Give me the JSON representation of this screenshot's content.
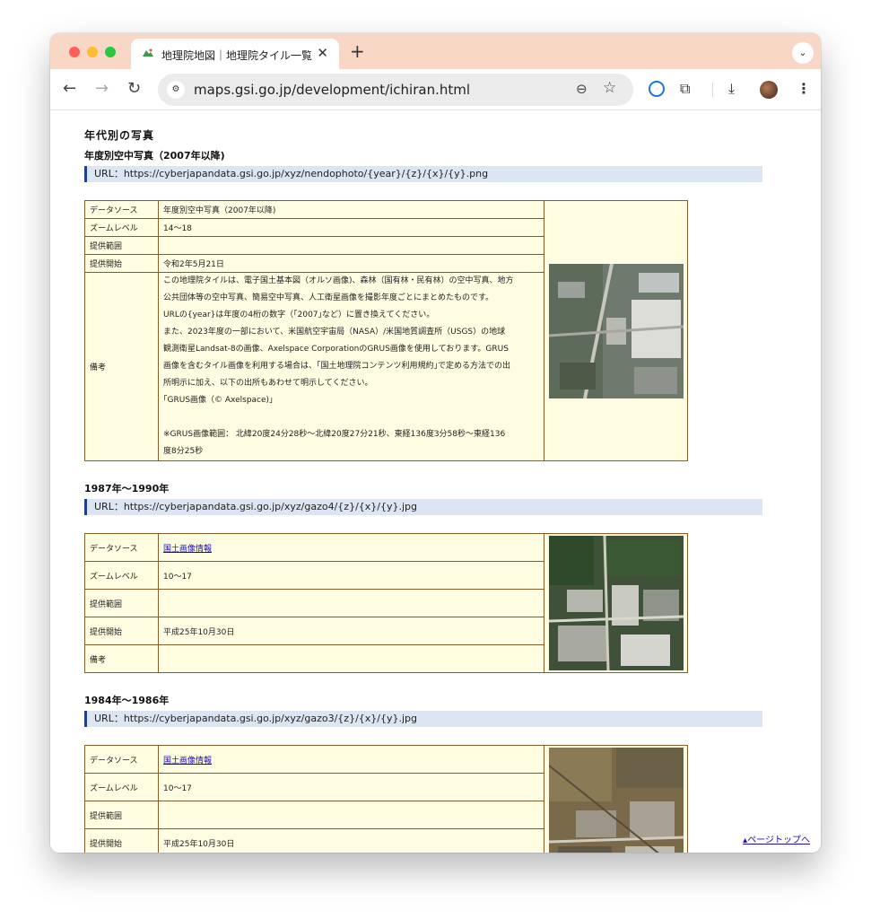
{
  "browser": {
    "tab_title": "地理院地図｜地理院タイル一覧",
    "tab_close": "✕",
    "new_tab": "+",
    "url": "maps.gsi.go.jp/development/ichiran.html"
  },
  "page": {
    "heading": "年代別の写真",
    "sections": [
      {
        "title": "年度別空中写真（2007年以降)",
        "url_line": "URL：https://cyberjapandata.gsi.go.jp/xyz/nendophoto/{year}/{z}/{x}/{y}.png",
        "rows": {
          "source_label": "データソース",
          "source_value": "年度別空中写真（2007年以降)",
          "zoom_label": "ズームレベル",
          "zoom_value": "14〜18",
          "range_label": "提供範囲",
          "range_value": "",
          "start_label": "提供開始",
          "start_value": "令和2年5月21日",
          "note_label": "備考",
          "note_lines": [
            "この地理院タイルは、電子国土基本図（オルソ画像)、森林（国有林・民有林）の空中写真、地方",
            "公共団体等の空中写真、簡易空中写真、人工衛星画像を撮影年度ごとにまとめたものです。",
            "URLの{year}は年度の4桁の数字（｢2007｣など）に置き換えてください。",
            "また、2023年度の一部において、米国航空宇宙局（NASA）/米国地質調査所（USGS）の地球",
            "観測衛星Landsat-8の画像、Axelspace CorporationのGRUS画像を使用しております。GRUS",
            "画像を含むタイル画像を利用する場合は、｢国土地理院コンテンツ利用規約｣で定める方法での出",
            "所明示に加え、以下の出所もあわせて明示してください。",
            "｢GRUS画像（© Axelspace)｣",
            "",
            "※GRUS画像範囲： 北緯20度24分28秒〜北緯20度27分21秒、東経136度3分58秒〜東経136",
            "度8分25秒"
          ]
        }
      },
      {
        "title": "1987年〜1990年",
        "url_line": "URL：https://cyberjapandata.gsi.go.jp/xyz/gazo4/{z}/{x}/{y}.jpg",
        "rows": {
          "source_label": "データソース",
          "source_value": "国土画像情報",
          "zoom_label": "ズームレベル",
          "zoom_value": "10〜17",
          "range_label": "提供範囲",
          "range_value": "",
          "start_label": "提供開始",
          "start_value": "平成25年10月30日",
          "note_label": "備考",
          "note_value": ""
        }
      },
      {
        "title": "1984年〜1986年",
        "url_line": "URL：https://cyberjapandata.gsi.go.jp/xyz/gazo3/{z}/{x}/{y}.jpg",
        "rows": {
          "source_label": "データソース",
          "source_value": "国土画像情報",
          "zoom_label": "ズームレベル",
          "zoom_value": "10〜17",
          "range_label": "提供範囲",
          "range_value": "",
          "start_label": "提供開始",
          "start_value": "平成25年10月30日"
        }
      }
    ],
    "page_top_link": "ページトップへ"
  },
  "colors": {
    "tabbar": "#f9d7c6",
    "table_bg": "#fffde1",
    "table_border": "#8a5b2a",
    "url_bar_bg": "#dce6f2",
    "link": "#1a0dab"
  }
}
